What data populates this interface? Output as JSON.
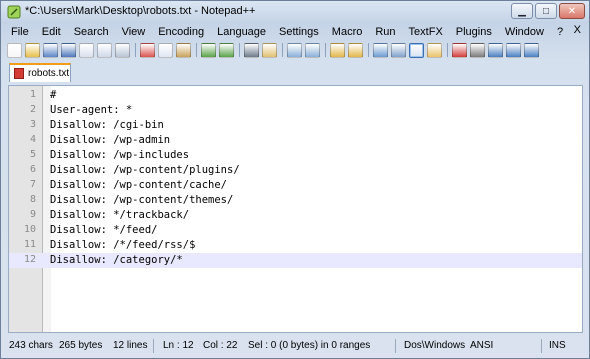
{
  "window": {
    "title": "*C:\\Users\\Mark\\Desktop\\robots.txt - Notepad++",
    "controls": {
      "minimize": "▁",
      "maximize": "□",
      "close": "✕"
    }
  },
  "menu": {
    "items": [
      "File",
      "Edit",
      "Search",
      "View",
      "Encoding",
      "Language",
      "Settings",
      "Macro",
      "Run",
      "TextFX",
      "Plugins",
      "Window",
      "?"
    ],
    "close_doc": "X"
  },
  "toolbar": {
    "buttons": [
      {
        "icon": "new-file-icon",
        "color": "#f7f7f7"
      },
      {
        "icon": "open-file-icon",
        "color": "#e8c14a"
      },
      {
        "icon": "save-icon",
        "color": "#5d86c8"
      },
      {
        "icon": "save-all-icon",
        "color": "#4f78bb"
      },
      {
        "icon": "close-file-icon",
        "color": "#d8e0ee"
      },
      {
        "icon": "close-all-icon",
        "color": "#cfd9ea"
      },
      {
        "icon": "print-icon",
        "color": "#b8c4d6"
      },
      {
        "sep": true
      },
      {
        "icon": "cut-icon",
        "color": "#d9534f"
      },
      {
        "icon": "copy-icon",
        "color": "#dfe7f4"
      },
      {
        "icon": "paste-icon",
        "color": "#c9a25a"
      },
      {
        "sep": true
      },
      {
        "icon": "undo-icon",
        "color": "#5aa34a"
      },
      {
        "icon": "redo-icon",
        "color": "#5aa34a"
      },
      {
        "sep": true
      },
      {
        "icon": "find-icon",
        "color": "#6c7a8c"
      },
      {
        "icon": "replace-icon",
        "color": "#e0c070"
      },
      {
        "sep": true
      },
      {
        "icon": "zoom-in-icon",
        "color": "#8bb0d8"
      },
      {
        "icon": "zoom-out-icon",
        "color": "#8bb0d8"
      },
      {
        "sep": true
      },
      {
        "icon": "sync-vertical-icon",
        "color": "#e2b84b"
      },
      {
        "icon": "sync-horizontal-icon",
        "color": "#e2b84b"
      },
      {
        "sep": true
      },
      {
        "icon": "word-wrap-icon",
        "color": "#6b9ad1"
      },
      {
        "icon": "show-all-chars-icon",
        "color": "#7fa1cb"
      },
      {
        "icon": "indent-guide-icon",
        "color": "#d8e3f2",
        "active": true
      },
      {
        "icon": "user-lang-icon",
        "color": "#e9c46a"
      },
      {
        "sep": true
      },
      {
        "icon": "record-macro-icon",
        "color": "#d23b3b"
      },
      {
        "icon": "stop-record-icon",
        "color": "#7a7a7a"
      },
      {
        "icon": "playback-macro-icon",
        "color": "#4a7fc2"
      },
      {
        "icon": "run-macro-multiple-icon",
        "color": "#4a7fc2"
      },
      {
        "icon": "save-macro-icon",
        "color": "#4a7fc2"
      }
    ]
  },
  "tabs": [
    {
      "label": "robots.txt",
      "icon": "file-modified-icon"
    }
  ],
  "editor": {
    "lines": [
      "#",
      "User-agent: *",
      "Disallow: /cgi-bin",
      "Disallow: /wp-admin",
      "Disallow: /wp-includes",
      "Disallow: /wp-content/plugins/",
      "Disallow: /wp-content/cache/",
      "Disallow: /wp-content/themes/",
      "Disallow: */trackback/",
      "Disallow: */feed/",
      "Disallow: /*/feed/rss/$",
      "Disallow: /category/*"
    ],
    "line_numbers": [
      "1",
      "2",
      "3",
      "4",
      "5",
      "6",
      "7",
      "8",
      "9",
      "10",
      "11",
      "12"
    ],
    "current_line": 12
  },
  "status": {
    "chars": "243 chars",
    "bytes": "265 bytes",
    "lines": "12 lines",
    "ln": "Ln : 12",
    "col": "Col : 22",
    "sel": "Sel : 0 (0 bytes) in 0 ranges",
    "eol": "Dos\\Windows",
    "encoding": "ANSI",
    "mode": "INS"
  }
}
